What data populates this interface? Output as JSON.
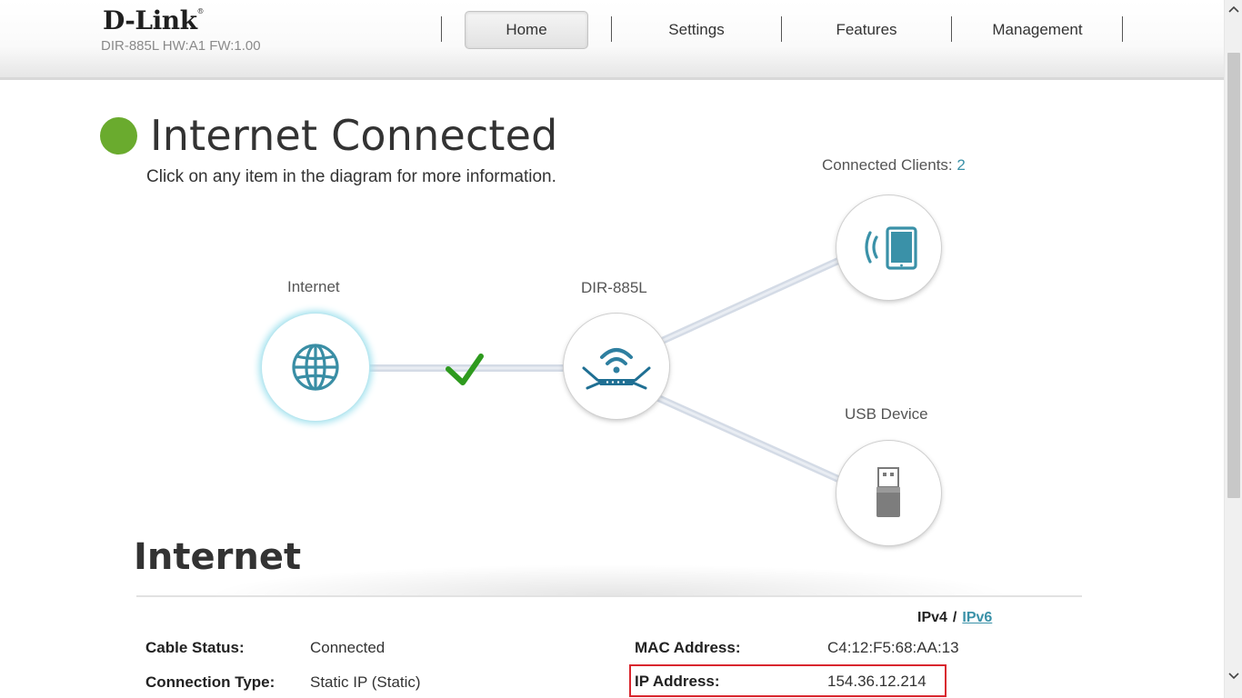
{
  "header": {
    "brand": "D-Link",
    "brand_mark": "®",
    "model_info": "DIR-885L HW:A1 FW:1.00",
    "nav": [
      {
        "label": "Home",
        "active": true
      },
      {
        "label": "Settings",
        "active": false
      },
      {
        "label": "Features",
        "active": false
      },
      {
        "label": "Management",
        "active": false
      }
    ]
  },
  "status": {
    "title": "Internet Connected",
    "hint": "Click on any item in the diagram for more information.",
    "indicator_color": "#6aab2e"
  },
  "diagram": {
    "internet_label": "Internet",
    "router_label": "DIR-885L",
    "clients_label": "Connected Clients: ",
    "clients_count": "2",
    "usb_label": "USB Device",
    "link_ok": true,
    "accent_color": "#3a91a8"
  },
  "section": {
    "title": "Internet",
    "ipv4_label": "IPv4",
    "separator": "/",
    "ipv6_label": "IPv6",
    "rows": {
      "cable_status_label": "Cable Status:",
      "cable_status_value": "Connected",
      "connection_type_label": "Connection Type:",
      "connection_type_value": "Static IP (Static)",
      "mac_label": "MAC Address:",
      "mac_value": "C4:12:F5:68:AA:13",
      "ip_label": "IP Address:",
      "ip_value": "154.36.12.214"
    },
    "highlight_color": "#d9262e"
  }
}
